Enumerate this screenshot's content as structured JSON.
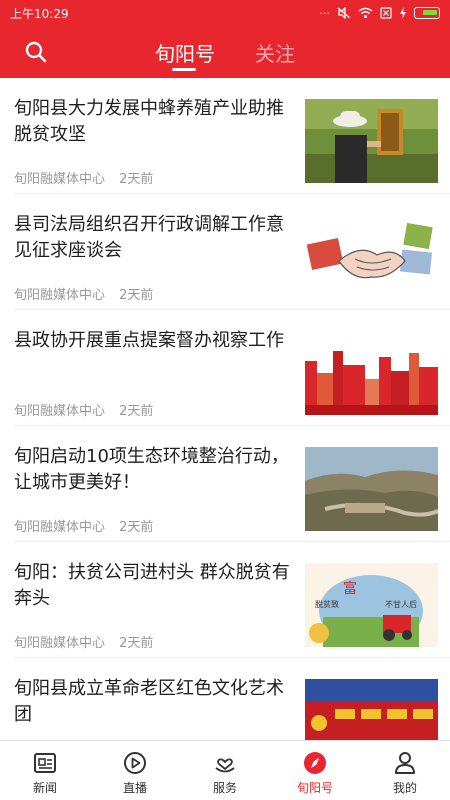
{
  "status": {
    "time": "上午10:29",
    "dots": "···"
  },
  "header": {
    "tabs": [
      "旬阳号",
      "关注"
    ],
    "active_tab": 0
  },
  "articles": [
    {
      "title": "旬阳县大力发展中蜂养殖产业助推脱贫攻坚",
      "source": "旬阳融媒体中心",
      "time": "2天前"
    },
    {
      "title": "县司法局组织召开行政调解工作意见征求座谈会",
      "source": "旬阳融媒体中心",
      "time": "2天前"
    },
    {
      "title": "县政协开展重点提案督办视察工作",
      "source": "旬阳融媒体中心",
      "time": "2天前"
    },
    {
      "title": "旬阳启动10项生态环境整治行动，让城市更美好！",
      "source": "旬阳融媒体中心",
      "time": "2天前"
    },
    {
      "title": "旬阳：扶贫公司进村头 群众脱贫有奔头",
      "source": "旬阳融媒体中心",
      "time": "2天前",
      "thumb_text": [
        "脱贫致",
        "富",
        "不甘人后"
      ]
    },
    {
      "title": "旬阳县成立革命老区红色文化艺术团",
      "source": "",
      "time": ""
    }
  ],
  "nav": [
    {
      "label": "新闻",
      "icon": "news-icon"
    },
    {
      "label": "直播",
      "icon": "play-icon"
    },
    {
      "label": "服务",
      "icon": "heart-hand-icon"
    },
    {
      "label": "旬阳号",
      "icon": "compass-icon",
      "active": true
    },
    {
      "label": "我的",
      "icon": "person-icon"
    }
  ],
  "colors": {
    "brand": "#e8262d",
    "text": "#1f1f1f",
    "meta": "#999999"
  }
}
